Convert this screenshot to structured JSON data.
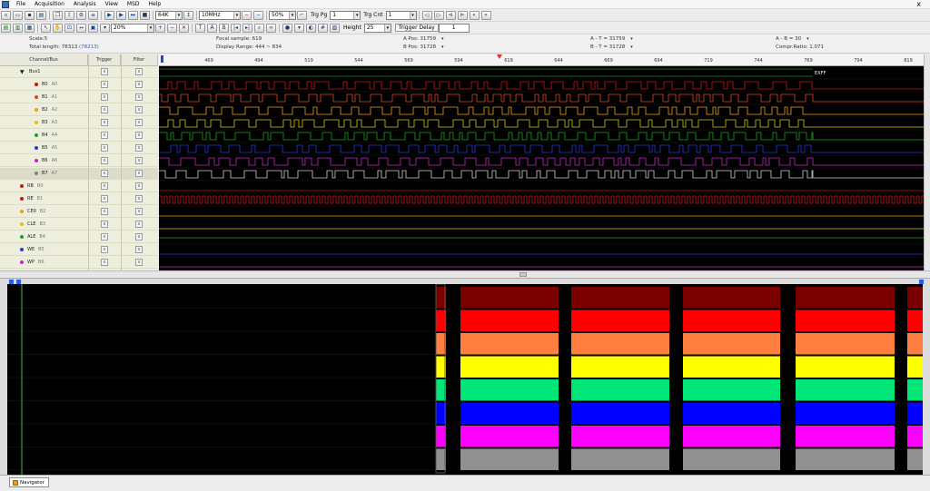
{
  "menu": [
    "File",
    "Acquisition",
    "Analysis",
    "View",
    "MSD",
    "Help"
  ],
  "window_close_glyph": "x",
  "toolbar1": {
    "depth_value": "64K",
    "rate_value": "10MHz",
    "trigger_pos_value": "50%",
    "trig_pg_label": "Trg Pg",
    "trig_pg_value": "1",
    "trig_cnt_label": "Trg Cnt",
    "trig_cnt_value": "1"
  },
  "toolbar2": {
    "zoom_value": "20%",
    "height_label": "Height",
    "height_value": "25",
    "trigger_delay_label": "Trigger Delay",
    "trigger_delay_value": "1"
  },
  "info": {
    "scale": "Scale:5",
    "total_length": "Total length: 78313",
    "total_length_extra": "(78213)",
    "focal_sample": "Focal sample: 619",
    "display_range": "Display Range: 444 ~ 834",
    "a_pos": "A Pos: 31759",
    "b_pos": "B Pos: 31728",
    "a_t": "A - T = 31759",
    "b_t": "B - T = 31728",
    "a_b": "A - B = 30",
    "compr_ratio": "Compr.Ratio: 1.071"
  },
  "columns": {
    "channel": "Channel/Bus",
    "trigger": "Trigger",
    "filter": "Filter"
  },
  "channels": [
    {
      "name": "Bus1",
      "sub": "",
      "color": "#000000",
      "bus": true
    },
    {
      "name": "B0",
      "sub": "A0",
      "color": "#c81414"
    },
    {
      "name": "B1",
      "sub": "A1",
      "color": "#d9481e"
    },
    {
      "name": "B2",
      "sub": "A2",
      "color": "#e8a020"
    },
    {
      "name": "B3",
      "sub": "A3",
      "color": "#d8c80c"
    },
    {
      "name": "B4",
      "sub": "A4",
      "color": "#1ea01e"
    },
    {
      "name": "B5",
      "sub": "A5",
      "color": "#2838d0"
    },
    {
      "name": "B6",
      "sub": "A6",
      "color": "#c028c0"
    },
    {
      "name": "B7",
      "sub": "A7",
      "color": "#808080"
    },
    {
      "name": "RB",
      "sub": "B0",
      "color": "#c81414"
    },
    {
      "name": "RE",
      "sub": "B1",
      "color": "#c81414"
    },
    {
      "name": "CE0",
      "sub": "B2",
      "color": "#e8a020"
    },
    {
      "name": "CLE",
      "sub": "B3",
      "color": "#d8c80c"
    },
    {
      "name": "ALE",
      "sub": "B4",
      "color": "#1ea01e"
    },
    {
      "name": "WE",
      "sub": "B5",
      "color": "#2838d0"
    },
    {
      "name": "WP",
      "sub": "B6",
      "color": "#c028c0"
    }
  ],
  "ruler_ticks": [
    "469",
    "494",
    "519",
    "544",
    "569",
    "594",
    "619",
    "644",
    "669",
    "694",
    "719",
    "744",
    "769",
    "794",
    "819"
  ],
  "bus_end_label": "EXFF",
  "navigator_tab": "Navigator",
  "colors": {
    "wave_bg": "#000000",
    "nav_red_dark": "#7a0000",
    "nav_red": "#ff0000",
    "nav_orange": "#ff7f40",
    "nav_yellow": "#ffff00",
    "nav_green": "#00e676",
    "nav_blue": "#0000ff",
    "nav_magenta": "#ff00ff",
    "nav_gray": "#909090"
  }
}
